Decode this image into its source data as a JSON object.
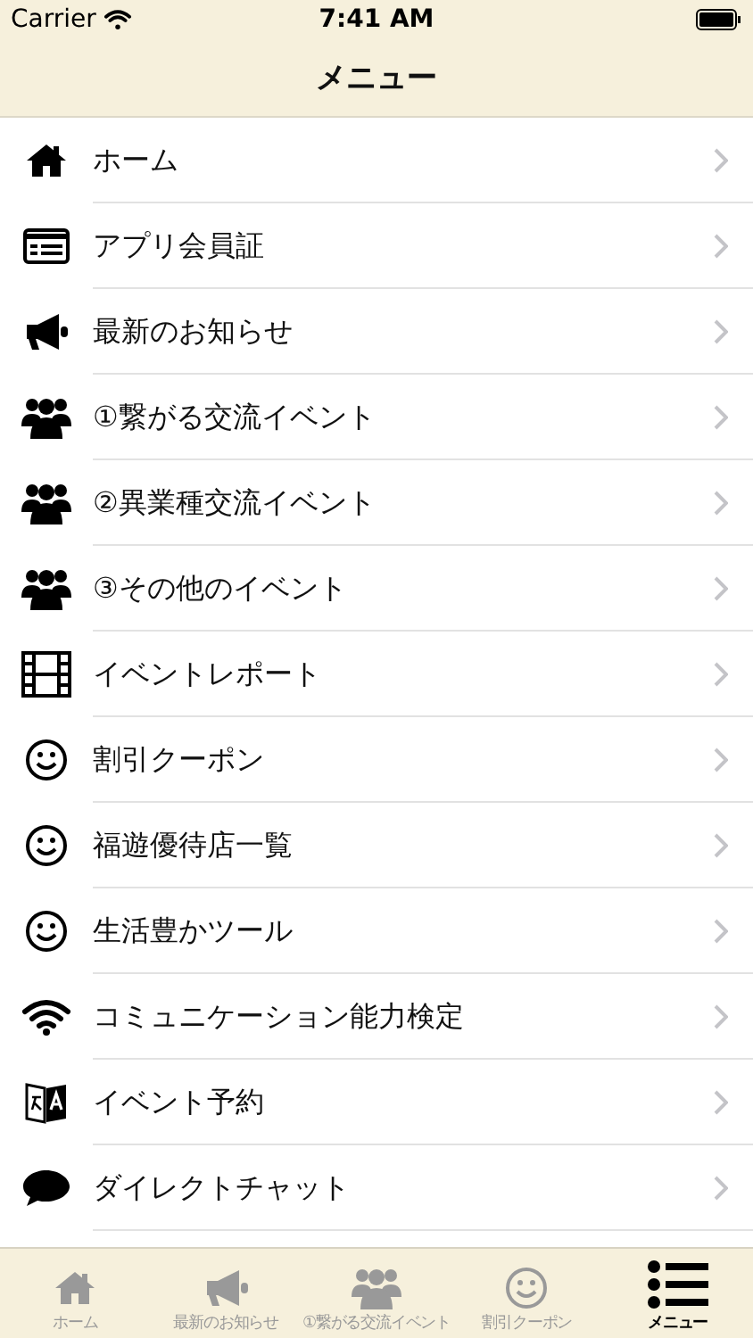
{
  "status_bar": {
    "carrier": "Carrier",
    "time": "7:41 AM"
  },
  "nav_bar": {
    "title": "メニュー"
  },
  "menu": [
    {
      "label": "ホーム",
      "kind": "home"
    },
    {
      "label": "アプリ会員証",
      "kind": "card"
    },
    {
      "label": "最新のお知らせ",
      "kind": "megaphone"
    },
    {
      "label": "①繋がる交流イベント",
      "kind": "group"
    },
    {
      "label": "②異業種交流イベント",
      "kind": "group"
    },
    {
      "label": "③その他のイベント",
      "kind": "group"
    },
    {
      "label": "イベントレポート",
      "kind": "film"
    },
    {
      "label": "割引クーポン",
      "kind": "smile"
    },
    {
      "label": "福遊優待店一覧",
      "kind": "smile"
    },
    {
      "label": "生活豊かツール",
      "kind": "smile"
    },
    {
      "label": "コミュニケーション能力検定",
      "kind": "wifi"
    },
    {
      "label": "イベント予約",
      "kind": "translate"
    },
    {
      "label": "ダイレクトチャット",
      "kind": "chat"
    }
  ],
  "tab_bar": [
    {
      "label": "ホーム",
      "kind": "home",
      "selected": false
    },
    {
      "label": "最新のお知らせ",
      "kind": "megaphone",
      "selected": false
    },
    {
      "label": "①繋がる交流イベント",
      "kind": "group",
      "selected": false
    },
    {
      "label": "割引クーポン",
      "kind": "smile",
      "selected": false
    },
    {
      "label": "メニュー",
      "kind": "list",
      "selected": true
    }
  ]
}
